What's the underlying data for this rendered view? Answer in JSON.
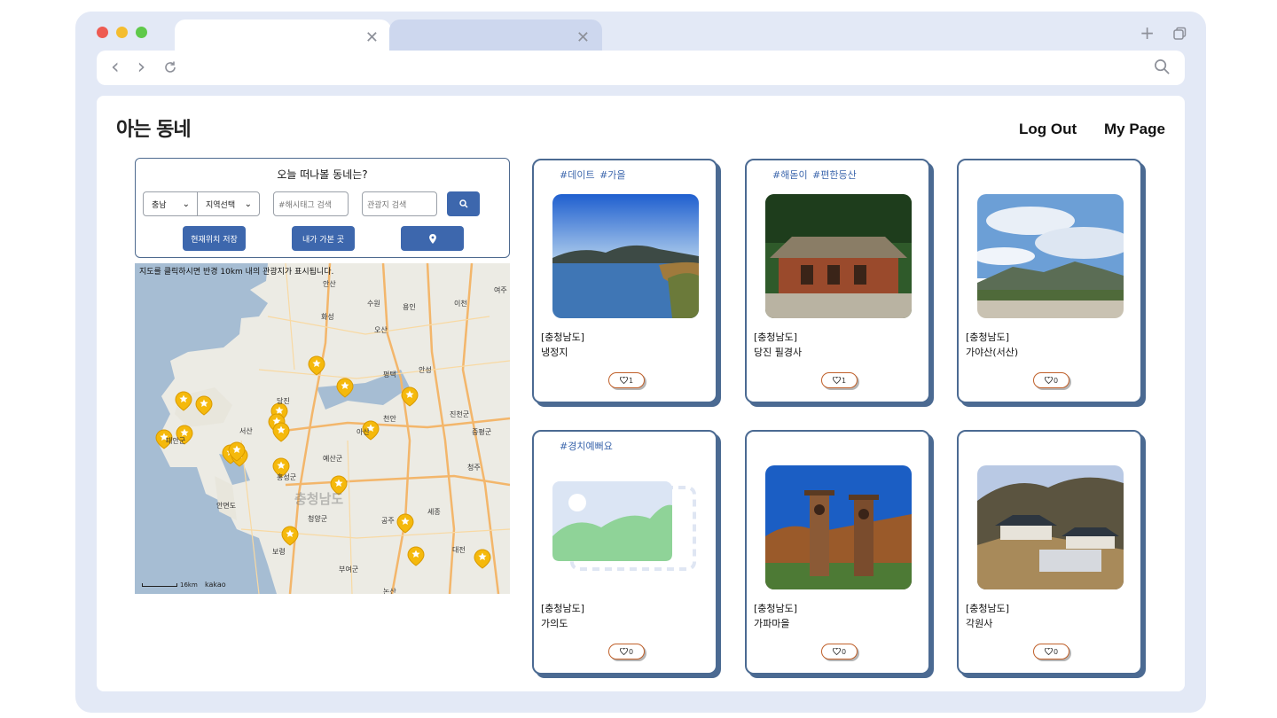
{
  "browser": {
    "dot_colors": [
      "#ee5b52",
      "#f4bd2f",
      "#5fc94a"
    ],
    "tab_close": "✕",
    "new_tab": "+",
    "back": "‹",
    "forward": "›"
  },
  "header": {
    "logo_text": "아는 동네",
    "logout_label": "Log Out",
    "mypage_label": "My Page"
  },
  "search": {
    "title": "오늘 떠나볼 동네는?",
    "province_select": "충남",
    "region_select": "지역선택",
    "hashtag_placeholder": "#해시태그 검색",
    "place_placeholder": "관광지 검색",
    "save_location_label": "현재위치 저장",
    "visited_label": "내가 가본 곳"
  },
  "map": {
    "note": "지도를 클릭하시면 반경 10km 내의 관광지가 표시됩니다.",
    "scale_label": "16km",
    "provider": "kakao",
    "labels": [
      {
        "text": "안산"
      },
      {
        "text": "화성"
      },
      {
        "text": "수원"
      },
      {
        "text": "용인"
      },
      {
        "text": "오산"
      },
      {
        "text": "평택"
      },
      {
        "text": "안성"
      },
      {
        "text": "당진"
      },
      {
        "text": "서산"
      },
      {
        "text": "아산"
      },
      {
        "text": "천안"
      },
      {
        "text": "예산군"
      },
      {
        "text": "홍성군"
      },
      {
        "text": "청양군"
      },
      {
        "text": "공주"
      },
      {
        "text": "세종"
      },
      {
        "text": "대전"
      },
      {
        "text": "보령"
      },
      {
        "text": "부여군"
      },
      {
        "text": "청주"
      },
      {
        "text": "진천군"
      },
      {
        "text": "증평군"
      },
      {
        "text": "태안군"
      },
      {
        "text": "안면도"
      },
      {
        "text": "충청남도"
      },
      {
        "text": "여주"
      },
      {
        "text": "이천"
      },
      {
        "text": "논산"
      }
    ]
  },
  "cards": [
    {
      "tags": "#데이트 #가을",
      "region": "[충청남도]",
      "name": "냉정지",
      "likes": "1",
      "image": "lake"
    },
    {
      "tags": "#해돋이 #편한등산",
      "region": "[충청남도]",
      "name": "당진 필경사",
      "likes": "1",
      "image": "house"
    },
    {
      "tags": "",
      "region": "[충청남도]",
      "name": "가야산(서산)",
      "likes": "0",
      "image": "mountain"
    },
    {
      "tags": "#경치예뻐요",
      "region": "[충청남도]",
      "name": "가의도",
      "likes": "0",
      "image": "placeholder"
    },
    {
      "tags": "",
      "region": "[충청남도]",
      "name": "가파마을",
      "likes": "0",
      "image": "totem"
    },
    {
      "tags": "",
      "region": "[충청남도]",
      "name": "각원사",
      "likes": "0",
      "image": "temple"
    }
  ]
}
